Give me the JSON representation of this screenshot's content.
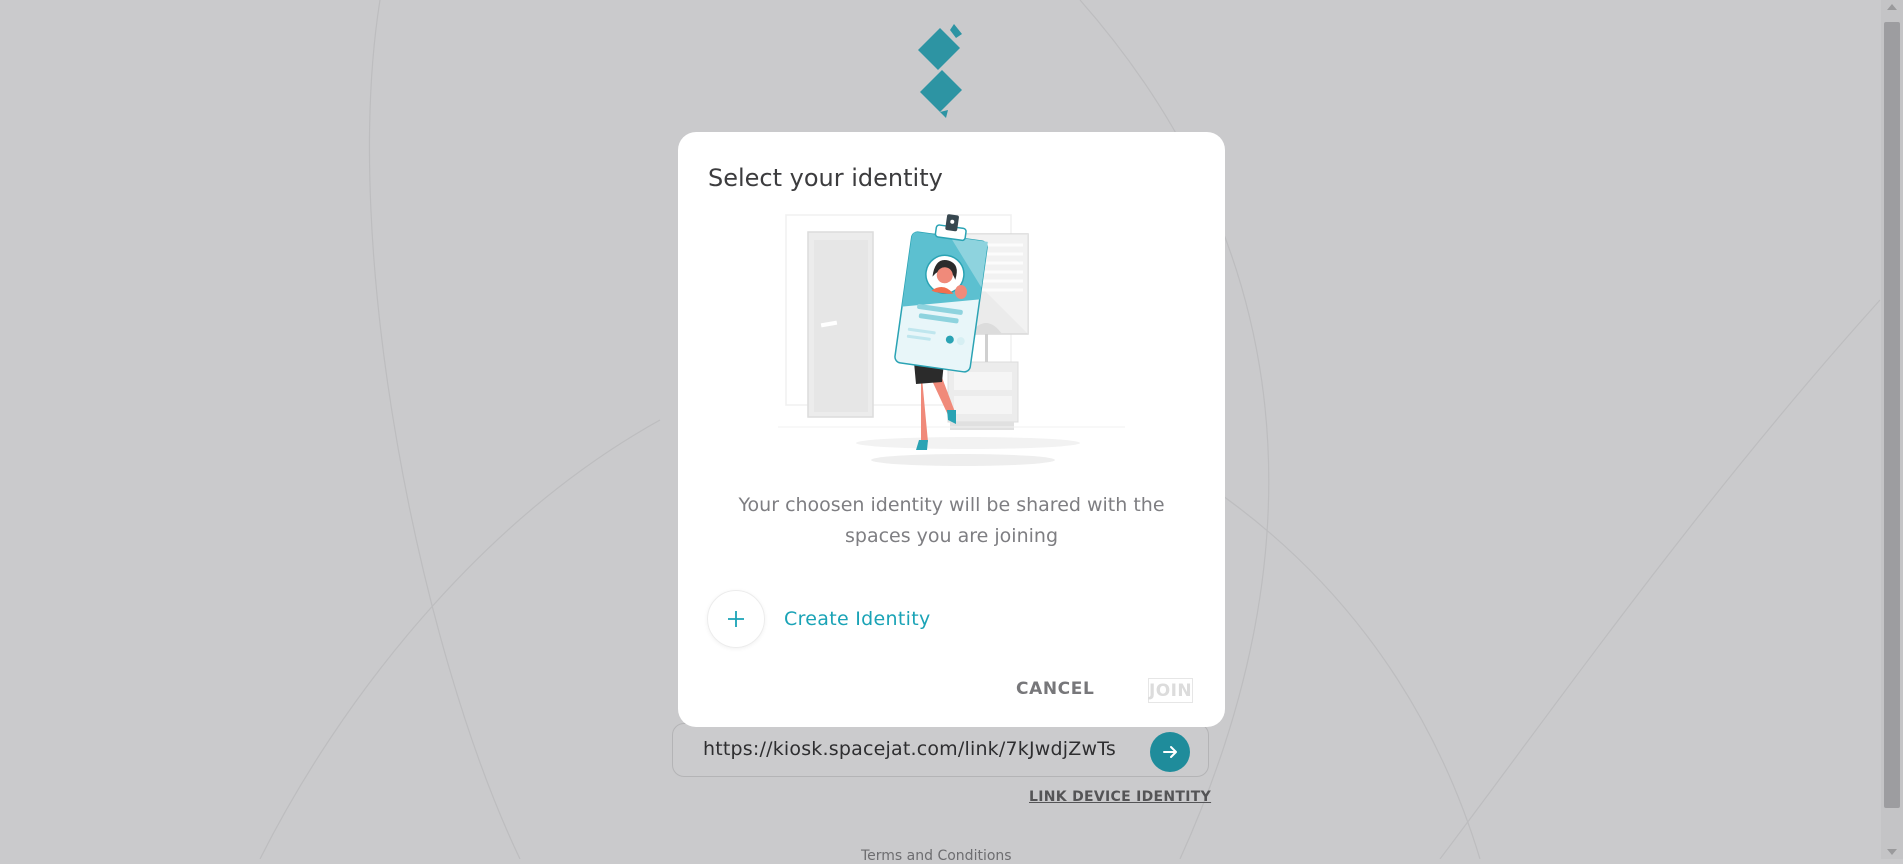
{
  "link_bar": {
    "url": "https://kiosk.spacejat.com/link/7kJwdjZwTs",
    "go_icon": "arrow-right-icon"
  },
  "link_device_label": "LINK DEVICE IDENTITY",
  "terms_label": "Terms and Conditions",
  "dialog": {
    "title": "Select your identity",
    "info": "Your choosen identity will be shared with the spaces you are joining",
    "create_label": "Create Identity",
    "create_icon": "plus-icon",
    "cancel_label": "CANCEL",
    "join_label": "JOIN"
  },
  "colors": {
    "accent": "#1aa3b6",
    "logo": "#2d94a3",
    "overlay_background": "#cacacc"
  }
}
